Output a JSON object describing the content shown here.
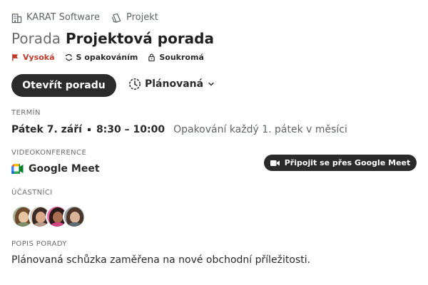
{
  "breadcrumb": {
    "company": "KARAT Software",
    "company_icon": "building-icon",
    "project": "Projekt",
    "project_icon": "project-icon"
  },
  "title": {
    "prefix": "Porada",
    "name": "Projektová porada"
  },
  "tags": {
    "priority": "Vysoká",
    "priority_icon": "flag-icon",
    "priority_color": "#c0392b",
    "recurrence": "S opakováním",
    "recurrence_icon": "repeat-icon",
    "privacy": "Soukromá",
    "privacy_icon": "lock-icon"
  },
  "actions": {
    "open_label": "Otevřít poradu",
    "status_label": "Plánovaná",
    "status_icon": "clock-icon"
  },
  "term": {
    "label": "TERMÍN",
    "date": "Pátek 7. září",
    "time": "8:30 – 10:00",
    "repeat": "Opakování každý 1. pátek v měsíci"
  },
  "video": {
    "label": "VIDEOKONFERENCE",
    "provider": "Google Meet",
    "provider_icon": "google-meet-icon",
    "join_label": "Připojit se přes Google Meet",
    "join_icon": "video-camera-icon"
  },
  "participants": {
    "label": "ÚČASTNÍCI",
    "avatars": [
      "avatar-1",
      "avatar-2",
      "avatar-3",
      "avatar-4"
    ]
  },
  "description": {
    "label": "POPIS PORADY",
    "text": "Plánovaná schůzka zaměřena na nové obchodní příležitosti."
  },
  "colors": {
    "button_dark": "#2b2b2b",
    "accent_red": "#c0392b",
    "muted_text": "#6b6b6b"
  }
}
